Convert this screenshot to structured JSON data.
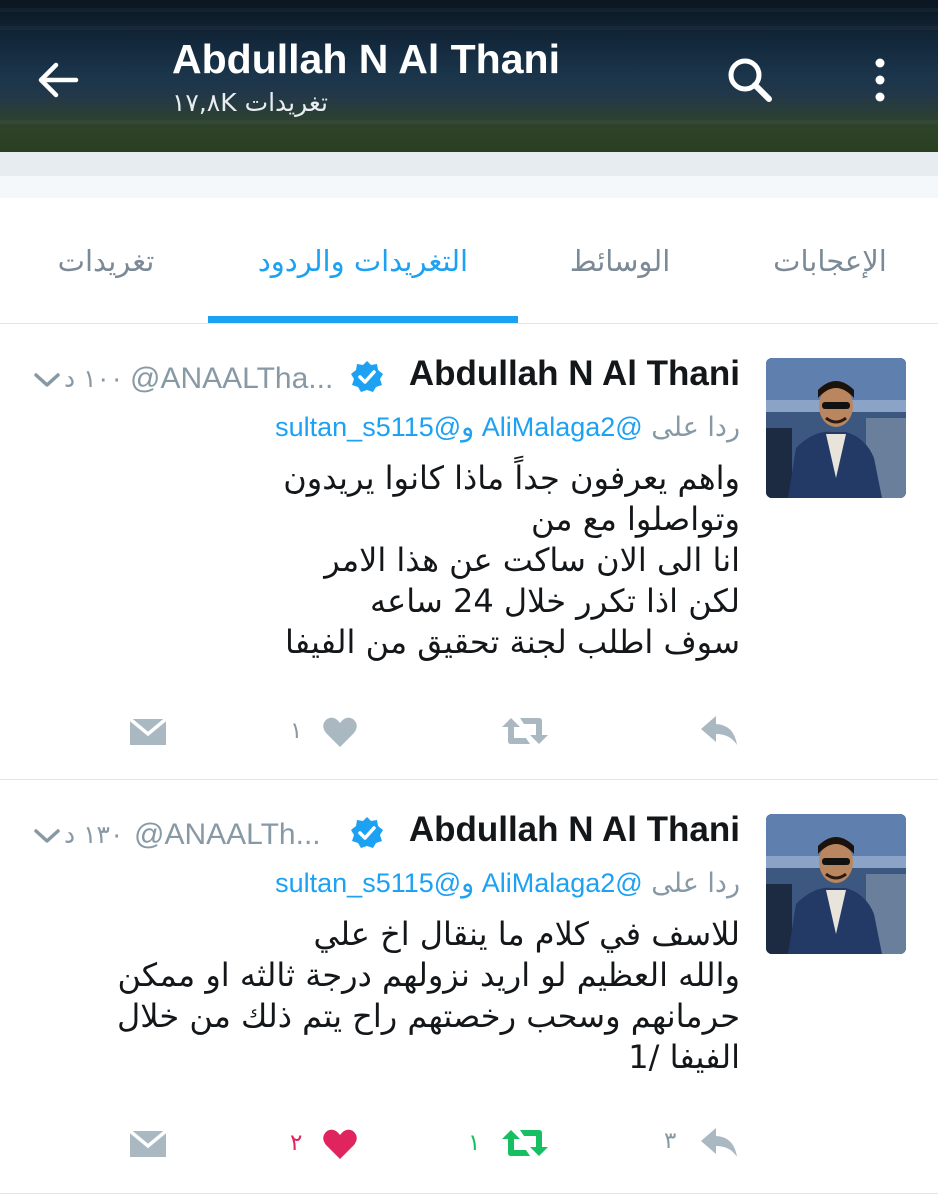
{
  "header": {
    "title": "Abdullah N Al Thani",
    "tweet_count": "١٧,٨K تغريدات"
  },
  "tabs": [
    {
      "label": "الإعجابات",
      "active": false
    },
    {
      "label": "الوسائط",
      "active": false
    },
    {
      "label": "التغريدات والردود",
      "active": true
    },
    {
      "label": "تغريدات",
      "active": false
    }
  ],
  "colors": {
    "accent": "#1da1f2",
    "like": "#e0245e",
    "retweet": "#17bf63",
    "muted": "#8899a6"
  },
  "icons": [
    "back-arrow-icon",
    "search-icon",
    "more-vertical-icon",
    "verified-badge-icon",
    "chevron-down-icon",
    "reply-icon",
    "retweet-icon",
    "heart-icon",
    "direct-message-icon"
  ],
  "tweets": [
    {
      "name": "Abdullah N Al Thani",
      "handle": "@ANAALTha...",
      "time": "١٠٠ د",
      "reply_prefix": "ردا على",
      "mentions": "@AliMalaga2 و@sultan_s5115",
      "lines": [
        "واهم يعرفون جداً ماذا كانوا يريدون",
        "وتواصلوا مع من",
        "انا الى الان ساكت عن هذا الامر",
        "لكن اذا تكرر خلال 24 ساعه",
        "سوف اطلب لجنة تحقيق من الفيفا"
      ],
      "reply_count": "",
      "retweet_count": "",
      "like_count": "١",
      "liked": false,
      "retweeted": false
    },
    {
      "name": "Abdullah N Al Thani",
      "handle": "@ANAALTh...",
      "time": "١٣٠ د",
      "reply_prefix": "ردا على",
      "mentions": "@AliMalaga2 و@sultan_s5115",
      "lines": [
        "للاسف في كلام ما ينقال اخ علي",
        "والله العظيم لو اريد نزولهم درجة ثالثه او ممكن",
        "حرمانهم وسحب رخصتهم راح يتم ذلك من خلال",
        "الفيفا /1"
      ],
      "reply_count": "٣",
      "retweet_count": "١",
      "like_count": "٢",
      "liked": true,
      "retweeted": true
    }
  ]
}
